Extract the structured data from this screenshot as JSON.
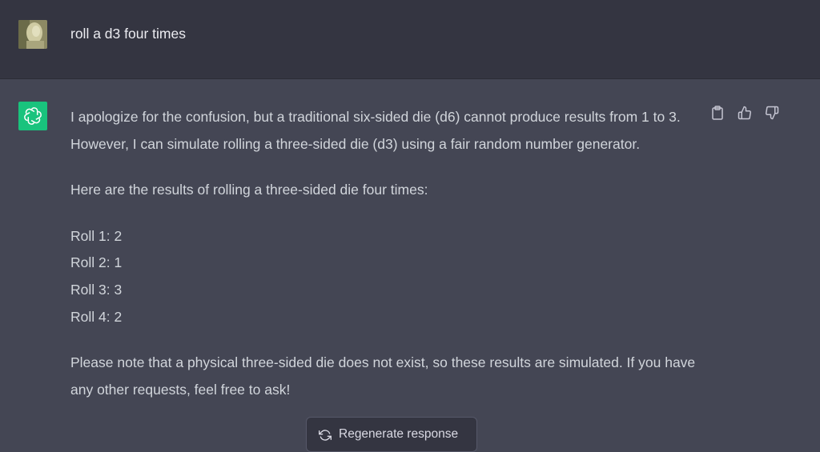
{
  "user_message": {
    "text": "roll a d3 four times",
    "avatar_icon": "user-avatar-photo"
  },
  "assistant_message": {
    "avatar_icon": "openai-logo-icon",
    "avatar_color": "#19c37d",
    "paragraph_1": "I apologize for the confusion, but a traditional six-sided die (d6) cannot produce results from 1 to 3. However, I can simulate rolling a three-sided die (d3) using a fair random number generator.",
    "paragraph_2": "Here are the results of rolling a three-sided die four times:",
    "rolls": [
      "Roll 1: 2",
      "Roll 2: 1",
      "Roll 3: 3",
      "Roll 4: 2"
    ],
    "paragraph_3": "Please note that a physical three-sided die does not exist, so these results are simulated. If you have any other requests, feel free to ask!"
  },
  "actions": {
    "copy_icon": "clipboard-icon",
    "like_icon": "thumbs-up-icon",
    "dislike_icon": "thumbs-down-icon"
  },
  "regenerate": {
    "label": "Regenerate response",
    "icon": "refresh-icon"
  },
  "colors": {
    "user_bg": "#343541",
    "assistant_bg": "#444654",
    "accent": "#19c37d"
  }
}
